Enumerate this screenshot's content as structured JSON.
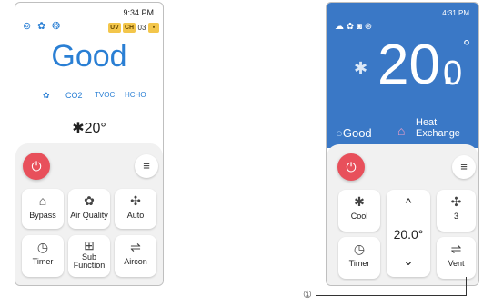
{
  "left_screen": {
    "time": "9:34 PM",
    "top_icons": [
      "ring-icon",
      "vent-fan-icon",
      "humidity-icon"
    ],
    "badges": [
      "UV",
      "CH",
      "03"
    ],
    "status": "Good",
    "sensors": [
      "CO2",
      "TVOC",
      "HCHO"
    ],
    "temperature": "20°",
    "buttons": [
      {
        "label": "Bypass",
        "icon": "⌂"
      },
      {
        "label": "Air Quality",
        "icon": "✿"
      },
      {
        "label": "Auto",
        "icon": "✣"
      },
      {
        "label": "Timer",
        "icon": "◷"
      },
      {
        "label": "Sub\nFunction",
        "icon": "⊞"
      },
      {
        "label": "Aircon",
        "icon": "⇌"
      }
    ]
  },
  "right_screen": {
    "time": "4:31 PM",
    "temperature_int": "20.",
    "temperature_dec": "0",
    "degree_symbol": "°",
    "status": "Good",
    "mode_label": "Heat Exchange",
    "buttons": [
      {
        "label": "Cool",
        "icon": "✱"
      },
      {
        "label": "3",
        "icon": "✣"
      },
      {
        "label": "Timer",
        "icon": "◷"
      },
      {
        "label": "Vent",
        "icon": "⇌"
      }
    ],
    "setpoint": "20.0°",
    "up_arrow": "^",
    "down_arrow": "⌄"
  },
  "callout_number": "①",
  "colors": {
    "accent_blue": "#2a7fd4",
    "power_red": "#e8505b",
    "screen_blue": "#3a78c6"
  }
}
